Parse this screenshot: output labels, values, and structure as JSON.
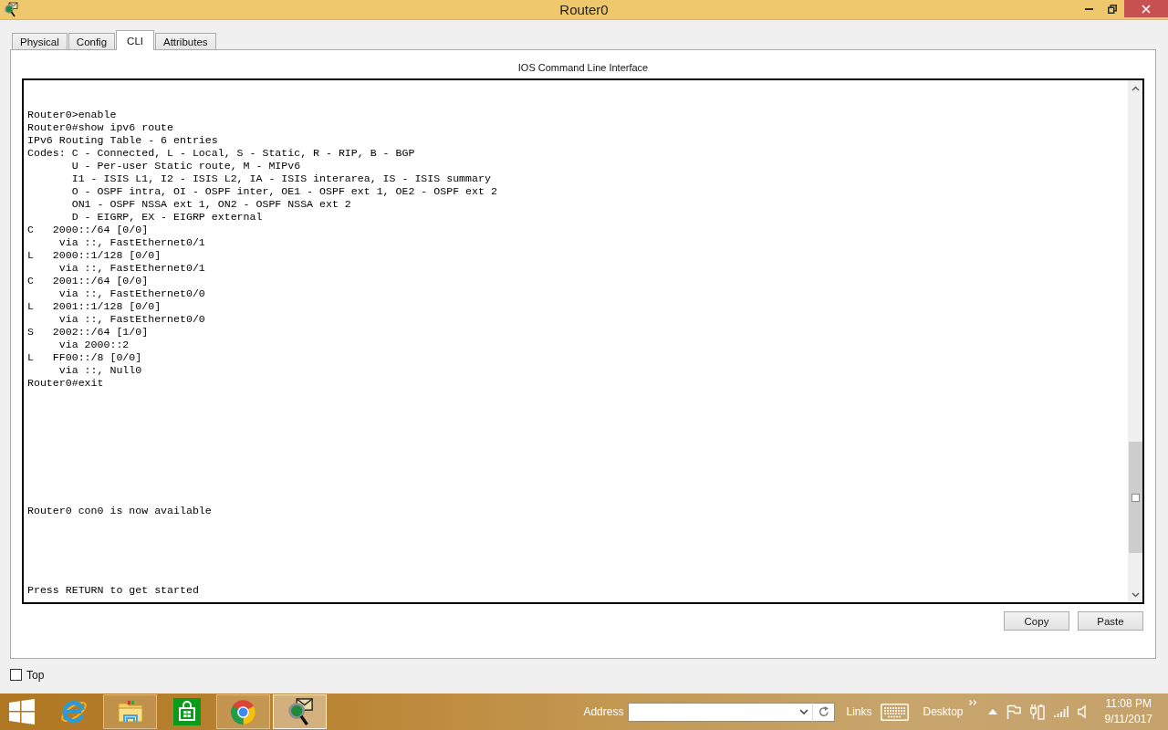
{
  "window": {
    "title": "Router0"
  },
  "tabs": [
    {
      "label": "Physical",
      "selected": false
    },
    {
      "label": "Config",
      "selected": false
    },
    {
      "label": "CLI",
      "selected": true
    },
    {
      "label": "Attributes",
      "selected": false
    }
  ],
  "cli_panel": {
    "title": "IOS Command Line Interface",
    "terminal": {
      "blocks": [
        {
          "lines": [
            "Router0>enable",
            "Router0#show ipv6 route",
            "IPv6 Routing Table - 6 entries",
            "Codes: C - Connected, L - Local, S - Static, R - RIP, B - BGP",
            "       U - Per-user Static route, M - MIPv6",
            "       I1 - ISIS L1, I2 - ISIS L2, IA - ISIS interarea, IS - ISIS summary",
            "       O - OSPF intra, OI - OSPF inter, OE1 - OSPF ext 1, OE2 - OSPF ext 2",
            "       ON1 - OSPF NSSA ext 1, ON2 - OSPF NSSA ext 2",
            "       D - EIGRP, EX - EIGRP external",
            "C   2000::/64 [0/0]",
            "     via ::, FastEthernet0/1",
            "L   2000::1/128 [0/0]",
            "     via ::, FastEthernet0/1",
            "C   2001::/64 [0/0]",
            "     via ::, FastEthernet0/0",
            "L   2001::1/128 [0/0]",
            "     via ::, FastEthernet0/0",
            "S   2002::/64 [1/0]",
            "     via 2000::2",
            "L   FF00::/8 [0/0]",
            "     via ::, Null0",
            "Router0#exit"
          ]
        },
        {
          "lines": [
            "Router0 con0 is now available"
          ]
        },
        {
          "lines": [
            "Press RETURN to get started"
          ]
        }
      ]
    },
    "buttons": [
      "Copy",
      "Paste"
    ]
  },
  "top_checkbox": {
    "label": "Top",
    "checked": false
  },
  "taskbar": {
    "apps": [
      {
        "kind": "ie",
        "running": false,
        "selected": false
      },
      {
        "kind": "explorer",
        "running": true,
        "selected": false
      },
      {
        "kind": "store",
        "running": false,
        "selected": false
      },
      {
        "kind": "chrome",
        "running": true,
        "selected": false
      },
      {
        "kind": "packet-tracer",
        "running": true,
        "selected": true
      }
    ],
    "address_toolbar": {
      "label": "Address"
    },
    "links_toolbar": {
      "label": "Links"
    },
    "desktop_toolbar": {
      "label": "Desktop"
    },
    "clock": {
      "time": "11:08 PM",
      "date": "9/11/2017"
    }
  }
}
